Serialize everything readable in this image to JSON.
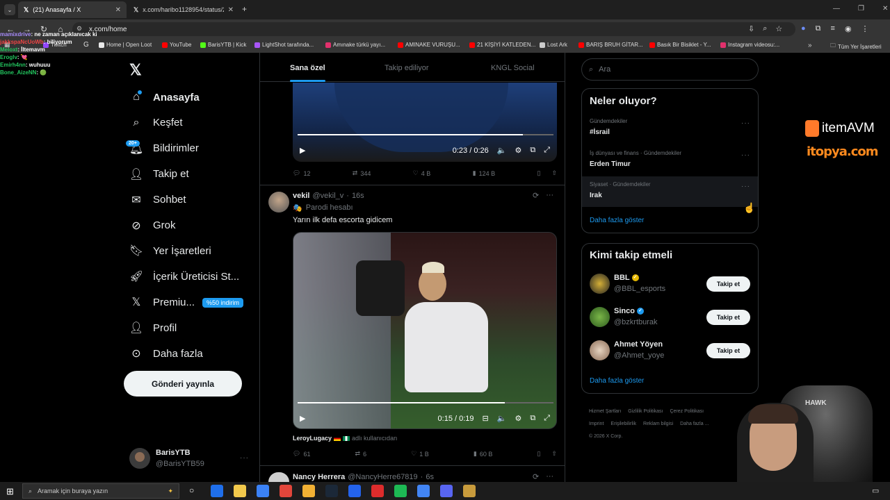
{
  "browser": {
    "tab1": "(21) Anasayfa / X",
    "tab2": "x.com/haribo1128954/status/2",
    "url": "x.com/home",
    "bookmarks": [
      "Twitch",
      "Home | Open Loot",
      "YouTube",
      "BarisYTB | Kick",
      "LightShot tarafında...",
      "Amınake türkü yayı...",
      "AMINAKE VURUŞU...",
      "21 KİŞİYİ KATLEDEN...",
      "Lost Ark",
      "BARIŞ BRUH GİTAR...",
      "Basık Bir Bisiklet - Y...",
      "Instagram videosu:..."
    ],
    "all_bookmarks": "Tüm Yer İşaretleri"
  },
  "chat": [
    {
      "user": "mamixdrive",
      "msg": ": ne zaman açıklanıcak ki",
      "color": "#a78bfa"
    },
    {
      "user": "jakkspaNcUoWb",
      "msg": ": biliyorum",
      "color": "#ef4444"
    },
    {
      "user": "Meloxt",
      "msg": ": İltemavm",
      "color": "#22c55e"
    },
    {
      "user": "Eroglv",
      "msg": ": 💘",
      "color": "#22c55e"
    },
    {
      "user": "Emirh4nn",
      "msg": ": wuhuuu",
      "color": "#22c55e"
    },
    {
      "user": "Bone_AizeNN",
      "msg": ": 🟢",
      "color": "#22c55e"
    }
  ],
  "nav": {
    "items": [
      {
        "label": "Anasayfa",
        "icon": "home-icon"
      },
      {
        "label": "Keşfet",
        "icon": "search-icon"
      },
      {
        "label": "Bildirimler",
        "icon": "bell-icon"
      },
      {
        "label": "Takip et",
        "icon": "add-user-icon"
      },
      {
        "label": "Sohbet",
        "icon": "mail-icon"
      },
      {
        "label": "Grok",
        "icon": "grok-icon"
      },
      {
        "label": "Yer İşaretleri",
        "icon": "bookmark-icon"
      },
      {
        "label": "İçerik Üreticisi St...",
        "icon": "rocket-icon"
      },
      {
        "label": "Premiu...",
        "icon": "x-logo-icon"
      },
      {
        "label": "Profil",
        "icon": "person-icon"
      },
      {
        "label": "Daha fazla",
        "icon": "more-circle-icon"
      }
    ],
    "notif_badge": "20+",
    "premium_badge": "%50 indirim",
    "post_button": "Gönderi yayınla"
  },
  "account": {
    "name": "BarisYTB",
    "handle": "@BarisYTB59"
  },
  "feed": {
    "tabs": [
      "Sana özel",
      "Takip ediliyor",
      "KNGL Social"
    ],
    "post1": {
      "time": "0:23 / 0:26",
      "progress": 0.88,
      "replies": "12",
      "reposts": "344",
      "likes": "4 B",
      "views": "124 B"
    },
    "post2": {
      "name": "vekil",
      "handle": "@vekil_v",
      "age": "16s",
      "parody": "Parodi hesabı",
      "text": "Yarın ilk defa escorta gidicem",
      "time": "0:15 / 0:19",
      "progress": 0.81,
      "caption_user": "LeroyLugacy",
      "caption_rest": "adlı kullanıcıdan",
      "replies": "61",
      "reposts": "6",
      "likes": "1 B",
      "views": "60 B"
    },
    "post3": {
      "name": "Nancy Herrera",
      "handle": "@NancyHerre67819",
      "age": "6s"
    }
  },
  "search": {
    "placeholder": "Ara"
  },
  "trends": {
    "title": "Neler oluyor?",
    "items": [
      {
        "cat": "Gündemdekiler",
        "name": "#İsrail"
      },
      {
        "cat": "İş dünyası ve finans · Gündemdekiler",
        "name": "Erden Timur"
      },
      {
        "cat": "Siyaset · Gündemdekiler",
        "name": "Irak"
      }
    ],
    "more": "Daha fazla göster"
  },
  "who": {
    "title": "Kimi takip etmeli",
    "items": [
      {
        "name": "BBL",
        "handle": "@BBL_esports",
        "verify": "#e6b800"
      },
      {
        "name": "Sinco",
        "handle": "@bzkrtburak",
        "verify": "#1d9bf0"
      },
      {
        "name": "Ahmet Yöyen",
        "handle": "@Ahmet_yoye",
        "verify": ""
      }
    ],
    "follow": "Takip et",
    "more": "Daha fazla göster"
  },
  "footer": {
    "links": [
      "Hizmet Şartları",
      "Gizlilik Politikası",
      "Çerez Politikası",
      "Imprint",
      "Erişilebilirlik",
      "Reklam bilgisi",
      "Daha fazla ..."
    ],
    "copy": "© 2026 X Corp."
  },
  "overlay": {
    "brand1": "itemAVM",
    "brand2": "itopya.com",
    "chair": "HAWK"
  },
  "taskbar": {
    "search": "Aramak için buraya yazın"
  }
}
